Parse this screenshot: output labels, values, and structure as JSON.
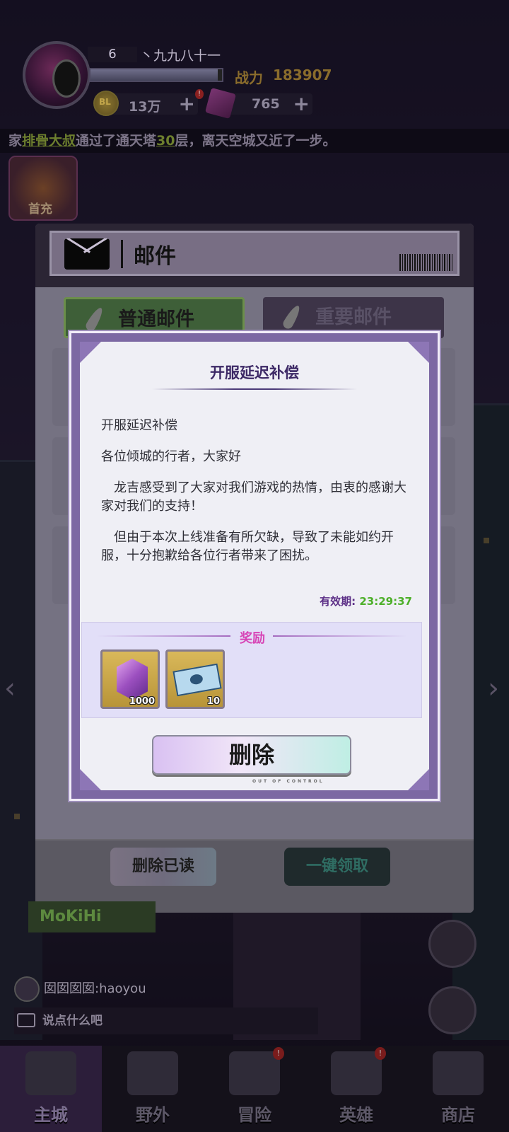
{
  "player": {
    "level": "6",
    "name": "丶九九八十一",
    "power_label": "战力",
    "power_value": "183907",
    "xp_fraction": 0.97,
    "coins": "13万",
    "coin_symbol": "BL",
    "gems": "765"
  },
  "ticker": {
    "prefix": "家",
    "player": "排骨大叔",
    "middle": "通过了通天塔",
    "floor": "30",
    "suffix": "层，离天空城又近了一步。"
  },
  "first_pay_label": "首充",
  "mail_window": {
    "title": "邮件",
    "tab_normal": "普通邮件",
    "tab_important": "重要邮件",
    "delete_read_button": "删除已读",
    "claim_all_button": "一键领取"
  },
  "mail_detail": {
    "title": "开服延迟补偿",
    "body": [
      "开服延迟补偿",
      "各位倾城的行者，大家好",
      "龙吉感受到了大家对我们游戏的热情，由衷的感谢大家对我们的支持！",
      "但由于本次上线准备有所欠缺，导致了未能如约开服，十分抱歉给各位行者带来了困扰。"
    ],
    "expiry_label": "有效期:",
    "expiry_time": "23:29:37",
    "rewards_title": "奖励",
    "rewards": [
      {
        "icon": "purple-gem-icon",
        "quantity": "1000"
      },
      {
        "icon": "ticket-icon",
        "quantity": "10"
      }
    ],
    "delete_button": "删除",
    "delete_button_sub": "OUT OF CONTROL"
  },
  "chat": {
    "sender": "囡囡囡囡:",
    "message": "haoyou",
    "input_placeholder": "说点什么吧"
  },
  "bottom_nav": [
    {
      "label": "主城",
      "active": true,
      "badge": ""
    },
    {
      "label": "野外",
      "active": false,
      "badge": ""
    },
    {
      "label": "冒险",
      "active": false,
      "badge": "!"
    },
    {
      "label": "英雄",
      "active": false,
      "badge": "!"
    },
    {
      "label": "商店",
      "active": false,
      "badge": ""
    }
  ],
  "background_sign": "MoKiHi",
  "colors": {
    "modal_title": "#3d2966",
    "reward_title": "#d745b6",
    "expiry_time": "#4caf28",
    "modal_frame": "#7c68a3"
  }
}
